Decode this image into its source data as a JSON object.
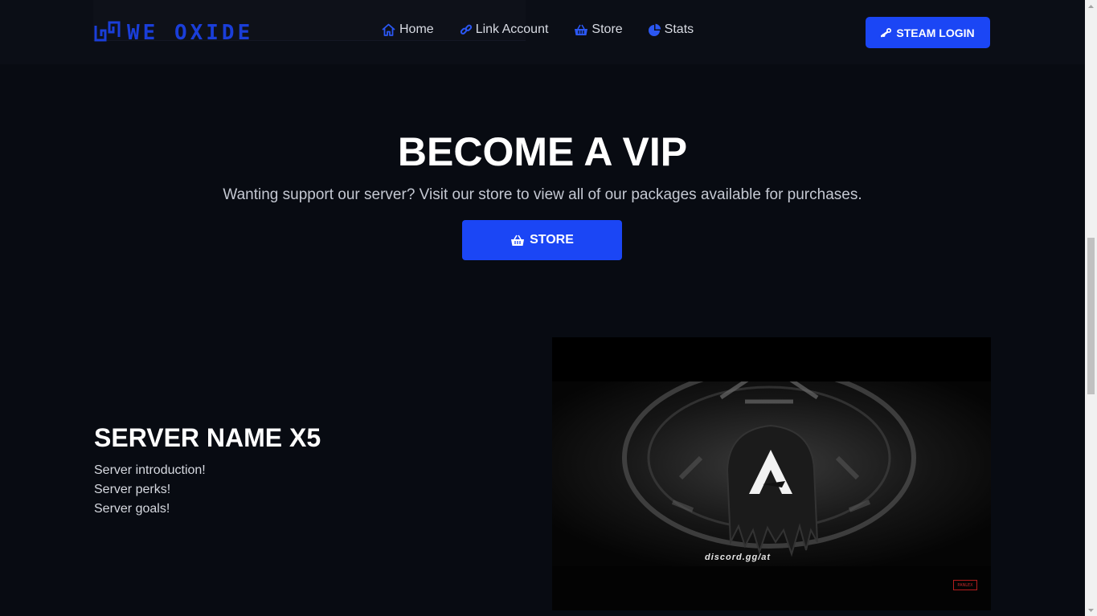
{
  "nav": {
    "logo_text": "WE OXIDE",
    "links": [
      {
        "label": "Home",
        "icon": "home-icon"
      },
      {
        "label": "Link Account",
        "icon": "link-icon"
      },
      {
        "label": "Store",
        "icon": "basket-icon"
      },
      {
        "label": "Stats",
        "icon": "pie-chart-icon"
      }
    ],
    "login_label": "STEAM LOGIN"
  },
  "vip": {
    "title": "BECOME A VIP",
    "subtitle": "Wanting support our server? Visit our store to view all of our packages available for purchases.",
    "store_label": "STORE"
  },
  "server": {
    "title": "SERVER NAME X5",
    "lines": [
      "Server introduction!",
      "Server perks!",
      "Server goals!"
    ]
  },
  "video": {
    "overlay_text": "discord.gg/at",
    "badge_text": "PANLEX"
  },
  "colors": {
    "accent": "#1b46f5",
    "background": "#080b12",
    "navbar": "#0b0e16"
  }
}
